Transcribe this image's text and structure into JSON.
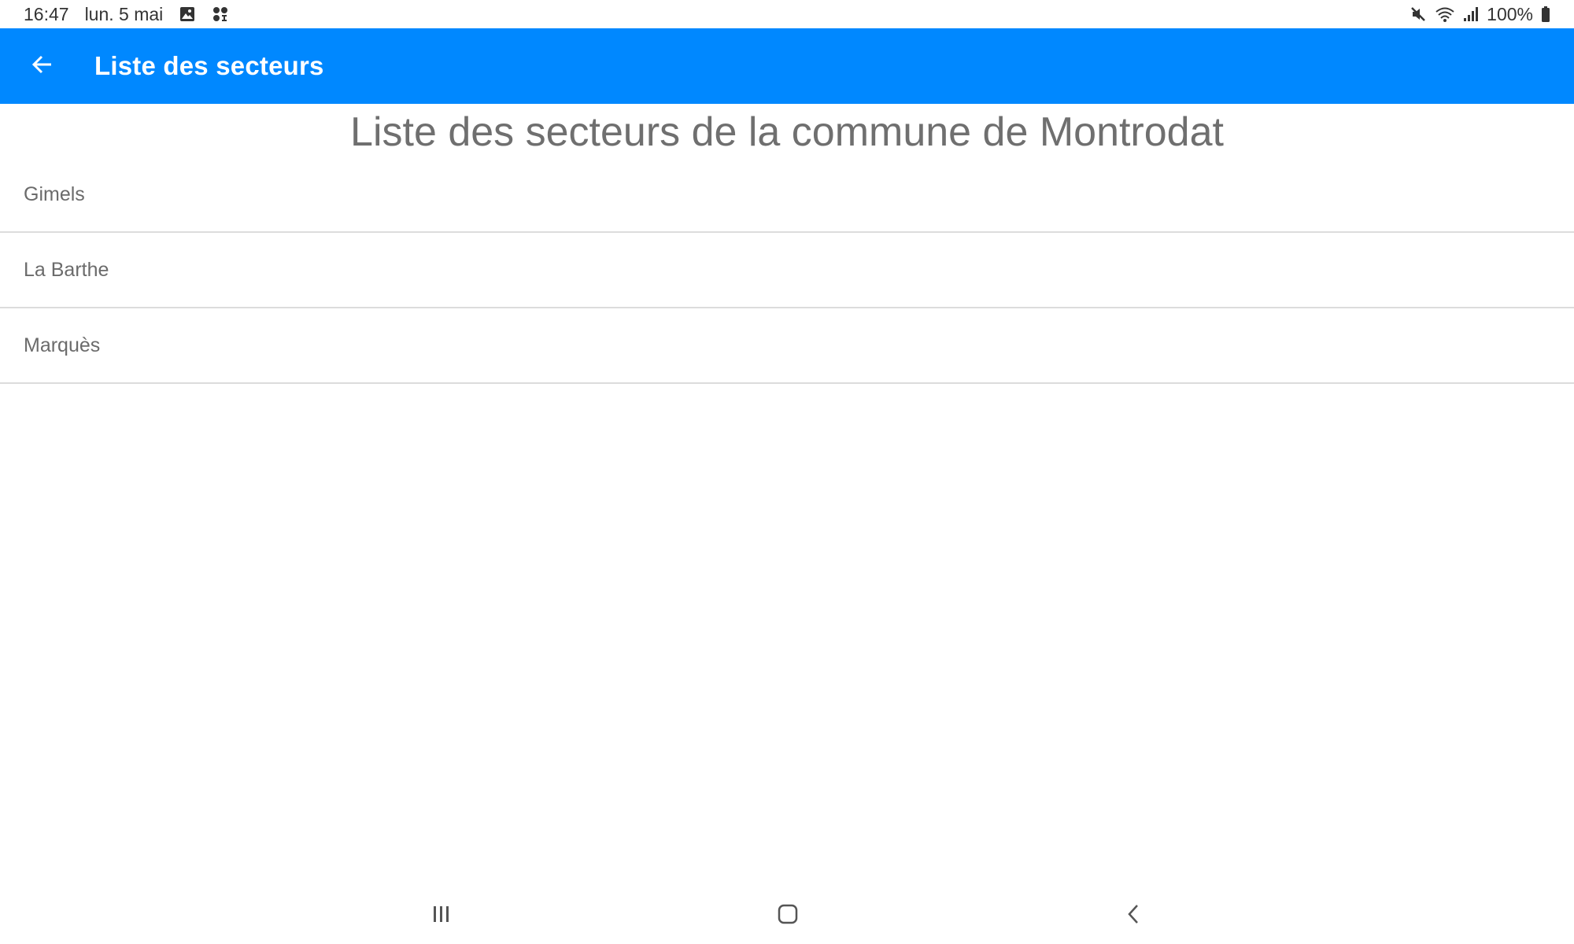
{
  "status_bar": {
    "time": "16:47",
    "date": "lun. 5 mai",
    "left_icons": [
      "image-notification-icon",
      "apps-notification-icon"
    ],
    "right_icons": [
      "mute-icon",
      "wifi-icon",
      "signal-icon",
      "battery-icon"
    ],
    "battery": "100%"
  },
  "app_bar": {
    "title": "Liste des secteurs",
    "background_color": "#0088ff",
    "back_icon": "arrow-left-icon"
  },
  "main": {
    "heading": "Liste des secteurs de la commune de Montrodat",
    "sectors": [
      {
        "label": "Gimels"
      },
      {
        "label": "La Barthe"
      },
      {
        "label": "Marquès"
      }
    ]
  },
  "nav_bar": {
    "buttons": [
      "recent-apps-icon",
      "home-icon",
      "back-icon"
    ]
  }
}
